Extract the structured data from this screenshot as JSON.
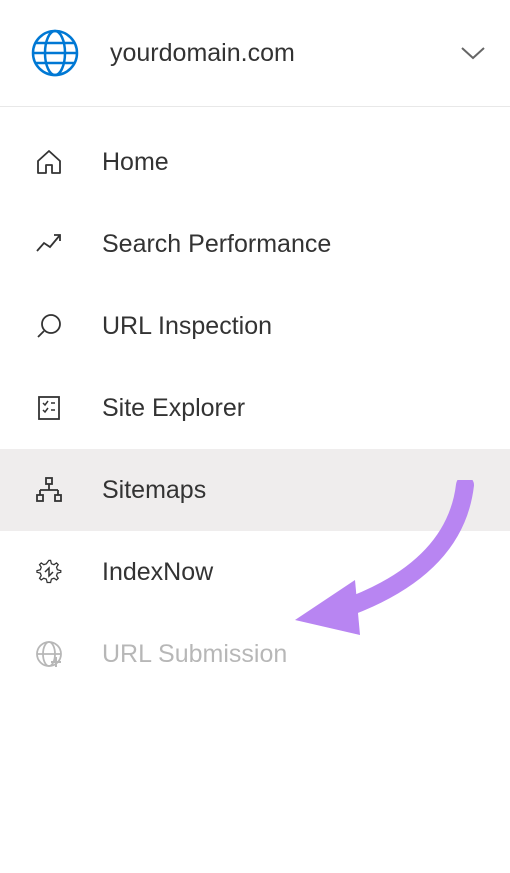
{
  "header": {
    "site_name": "yourdomain.com"
  },
  "nav": {
    "items": [
      {
        "label": "Home"
      },
      {
        "label": "Search Performance"
      },
      {
        "label": "URL Inspection"
      },
      {
        "label": "Site Explorer"
      },
      {
        "label": "Sitemaps"
      },
      {
        "label": "IndexNow"
      },
      {
        "label": "URL Submission"
      }
    ]
  }
}
